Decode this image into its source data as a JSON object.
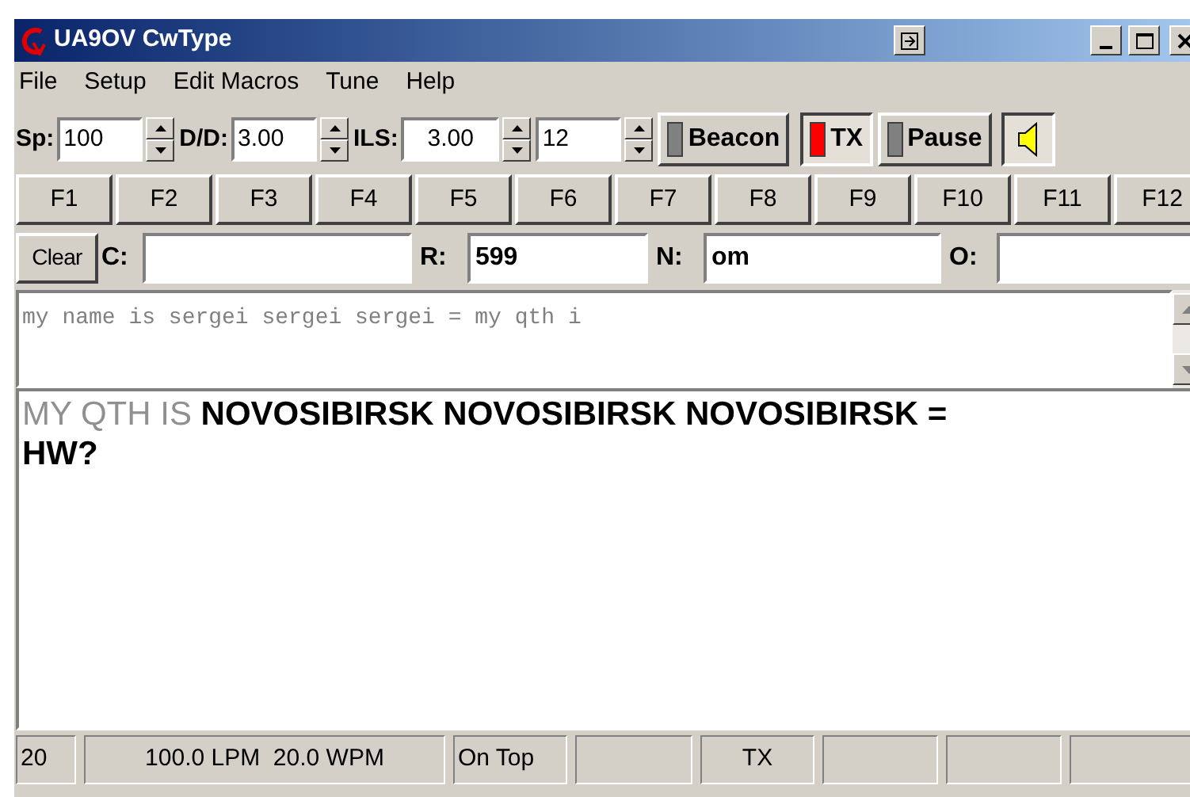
{
  "window": {
    "title": "UA9OV CwType"
  },
  "menu": [
    {
      "label": "File"
    },
    {
      "label": "Setup"
    },
    {
      "label": "Edit Macros"
    },
    {
      "label": "Tune"
    },
    {
      "label": "Help"
    }
  ],
  "toolbar": {
    "spinners": [
      {
        "label": "Sp:",
        "value": "100"
      },
      {
        "label": "D/D:",
        "value": "3.00"
      },
      {
        "label": "ILS:",
        "value": "3.00"
      },
      {
        "value": "12"
      }
    ],
    "toggles": [
      {
        "label": "Beacon",
        "on": false
      },
      {
        "label": "TX",
        "on": true
      },
      {
        "label": "Pause",
        "on": false
      }
    ],
    "sound": {
      "on": true
    }
  },
  "macro_keys": [
    "F1",
    "F2",
    "F3",
    "F4",
    "F5",
    "F6",
    "F7",
    "F8",
    "F9",
    "F10",
    "F11",
    "F12"
  ],
  "qso": {
    "clear_button": {
      "label": "Clear"
    },
    "fields": [
      {
        "label": "C:"
      },
      {
        "label": "R:",
        "value": "599"
      },
      {
        "label": "N:",
        "value": "om"
      },
      {
        "label": "O:"
      }
    ]
  },
  "send_text": "my name is sergei sergei sergei = my qth i",
  "receive": [
    {
      "text": "MY QTH IS ",
      "echoed": true
    },
    {
      "text": "NOVOSIBIRSK NOVOSIBIRSK NOVOSIBIRSK =\nHW?",
      "echoed": false
    }
  ],
  "status_bar": [
    {
      "kind": "text",
      "text": "20"
    },
    {
      "kind": "text",
      "text": "100.0 LPM  20.0 WPM"
    },
    {
      "kind": "text",
      "text": "On Top"
    },
    {
      "kind": "blank"
    },
    {
      "kind": "text",
      "text": "TX"
    },
    {
      "kind": "blank"
    },
    {
      "kind": "blank"
    },
    {
      "kind": "blank"
    }
  ]
}
